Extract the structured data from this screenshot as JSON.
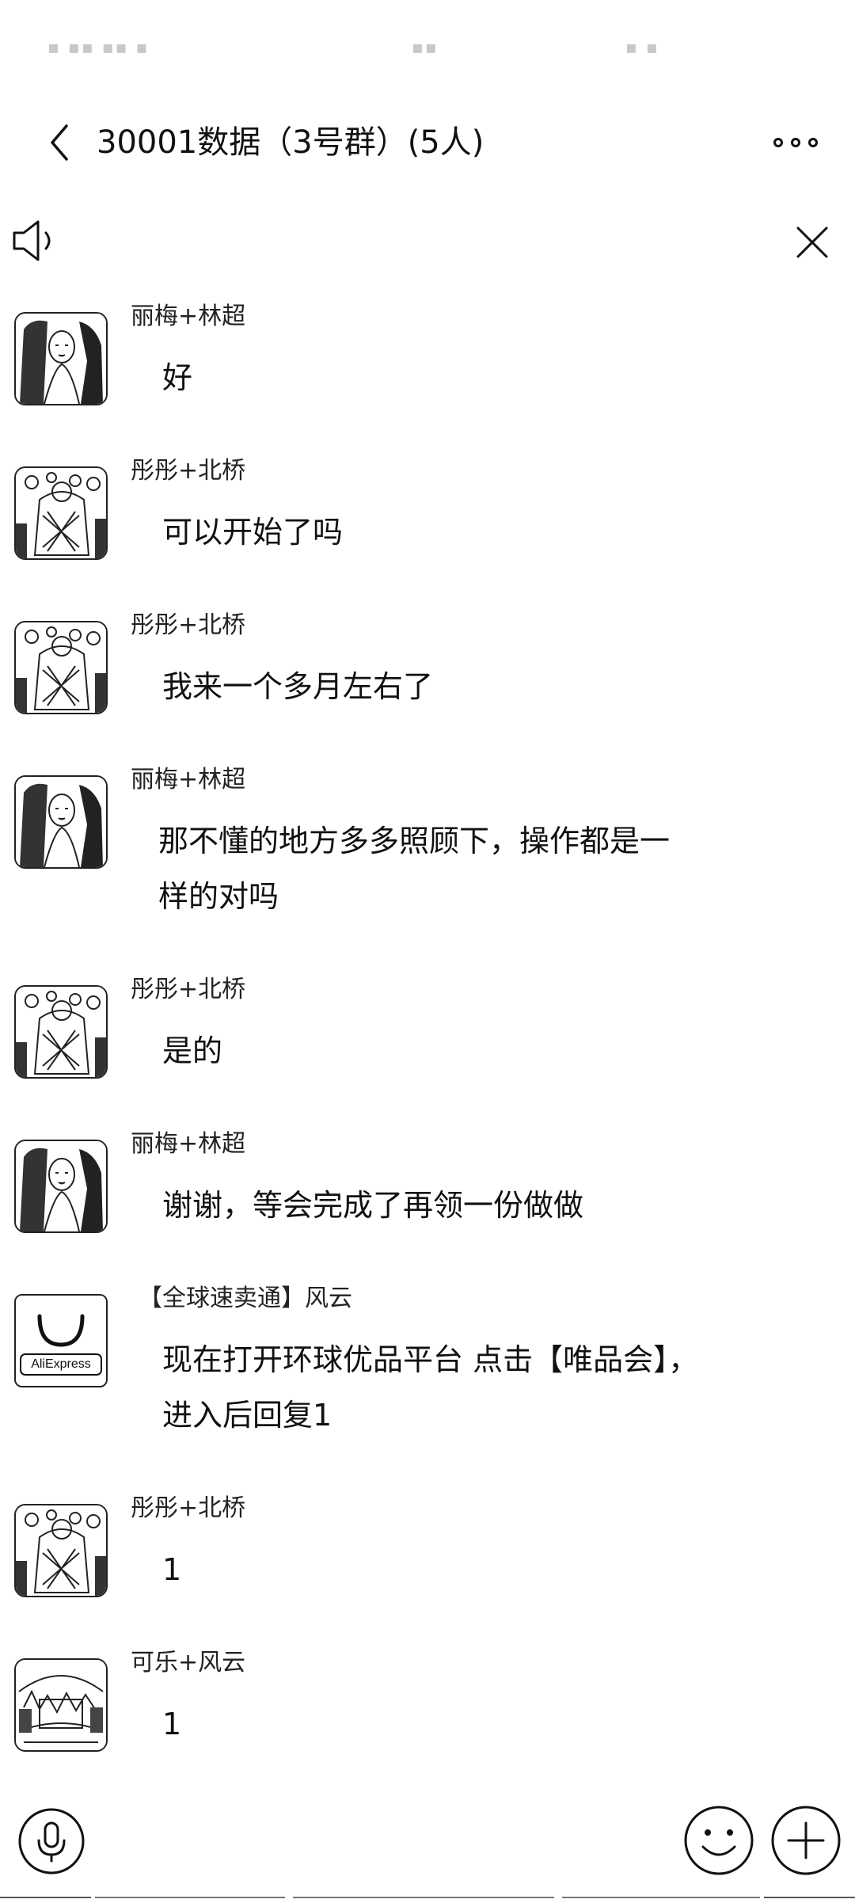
{
  "header": {
    "title": "30001数据（3号群）(5人)"
  },
  "messages": [
    {
      "sender": "丽梅+林超",
      "text": "好",
      "avatar": "woman-photo"
    },
    {
      "sender": "彤彤+北桥",
      "text": "可以开始了吗",
      "avatar": "group-photo"
    },
    {
      "sender": "彤彤+北桥",
      "text": "我来一个多月左右了",
      "avatar": "group-photo"
    },
    {
      "sender": "丽梅+林超",
      "text": "那不懂的地方多多照顾下，操作都是一样的对吗",
      "avatar": "woman-photo"
    },
    {
      "sender": "彤彤+北桥",
      "text": "是的",
      "avatar": "group-photo"
    },
    {
      "sender": "丽梅+林超",
      "text": "谢谢，等会完成了再领一份做做",
      "avatar": "woman-photo"
    },
    {
      "sender": "【全球速卖通】风云",
      "text": "现在打开环球优品平台  点击【唯品会】，进入后回复1",
      "avatar": "aliexpress-logo",
      "logo_text": "AliExpress"
    },
    {
      "sender": "彤彤+北桥",
      "text": "1",
      "avatar": "group-photo"
    },
    {
      "sender": "可乐+风云",
      "text": "1",
      "avatar": "landscape-photo"
    }
  ],
  "icons": {
    "back": "chevron-left-icon",
    "more": "more-dots-icon",
    "speaker": "speaker-icon",
    "close": "close-icon",
    "voice": "microphone-icon",
    "emoji": "emoji-icon",
    "plus": "plus-icon"
  }
}
